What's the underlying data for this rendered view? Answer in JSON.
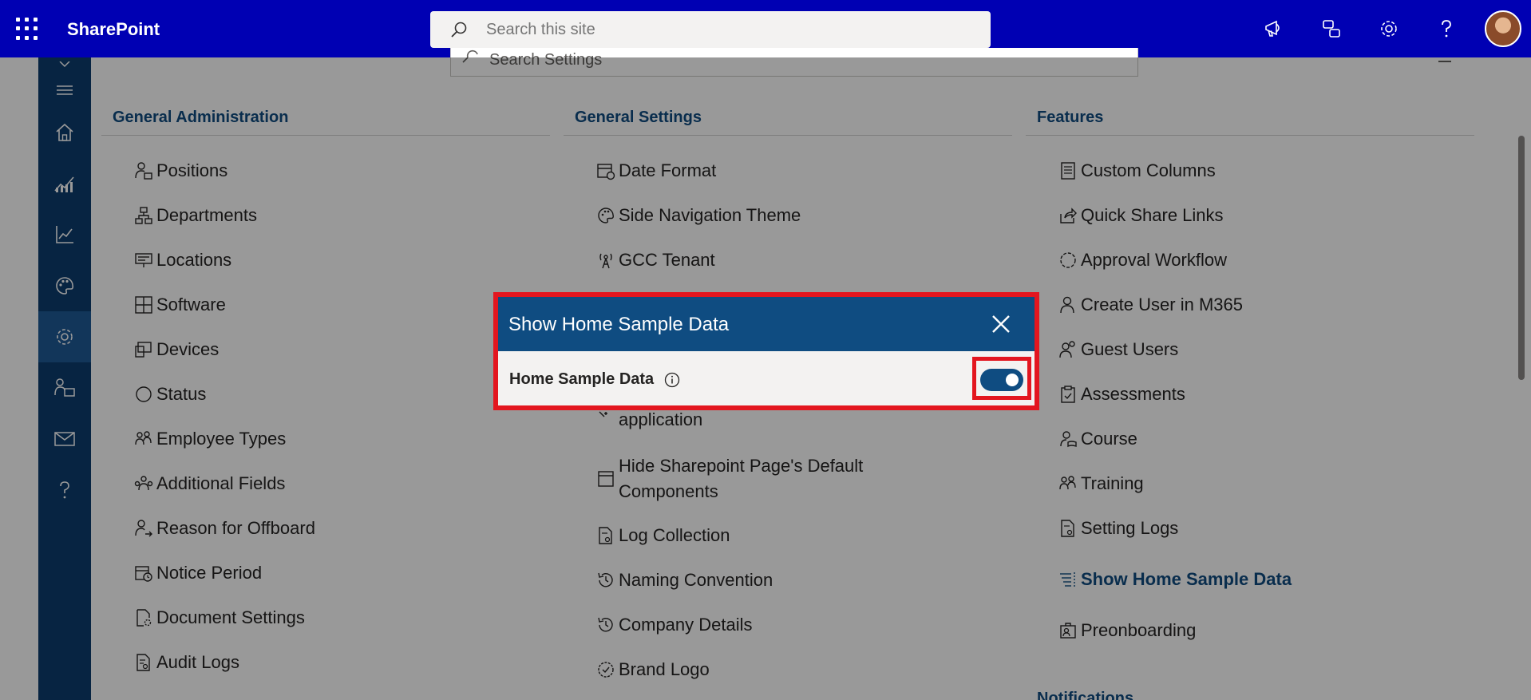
{
  "suitebar": {
    "brand": "SharePoint",
    "search_placeholder": "Search this site"
  },
  "settings_search": {
    "placeholder": "Search Settings"
  },
  "panels": {
    "general_admin": {
      "title": "General Administration",
      "items": [
        "Positions",
        "Departments",
        "Locations",
        "Software",
        "Devices",
        "Status",
        "Employee Types",
        "Additional Fields",
        "Reason for Offboard",
        "Notice Period",
        "Document Settings",
        "Audit Logs"
      ]
    },
    "general_settings": {
      "title": "General Settings",
      "items": [
        "Date Format",
        "Side Navigation Theme",
        "GCC Tenant",
        "application",
        "Hide Sharepoint Page's Default",
        "Components",
        "Log Collection",
        "Naming Convention",
        "Company Details",
        "Brand Logo"
      ]
    },
    "features": {
      "title": "Features",
      "items": [
        "Custom Columns",
        "Quick Share Links",
        "Approval Workflow",
        "Create User in M365",
        "Guest Users",
        "Assessments",
        "Course",
        "Training",
        "Setting Logs",
        "Show Home Sample Data",
        "Preonboarding"
      ],
      "next_section": "Notifications"
    }
  },
  "dialog": {
    "title": "Show Home Sample Data",
    "label": "Home Sample Data",
    "toggle_on": true
  },
  "colors": {
    "suitebar": "#0000b3",
    "leftnav": "#0d3d6e",
    "accent": "#0f4c81",
    "highlight_border": "#e3161f"
  }
}
